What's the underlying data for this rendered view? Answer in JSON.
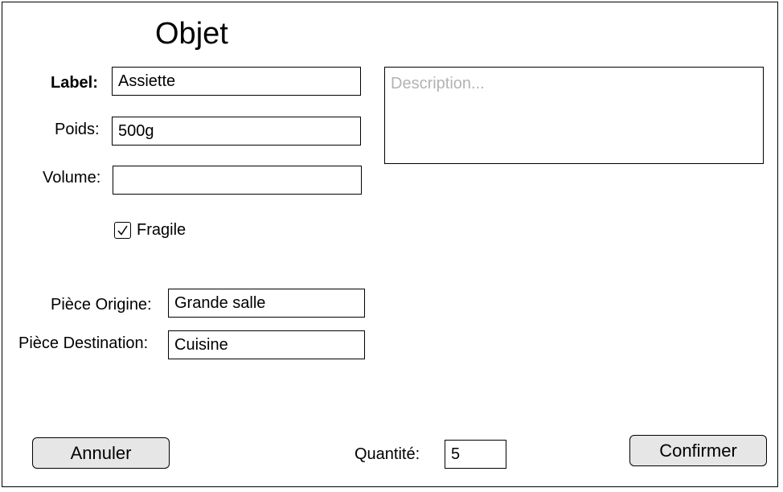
{
  "form": {
    "title": "Objet",
    "label": {
      "caption": "Label:",
      "value": "Assiette"
    },
    "poids": {
      "caption": "Poids:",
      "value": "500g"
    },
    "volume": {
      "caption": "Volume:",
      "value": ""
    },
    "description": {
      "placeholder": "Description...",
      "value": ""
    },
    "fragile": {
      "caption": "Fragile",
      "checked": true
    },
    "piece_origine": {
      "caption": "Pièce Origine:",
      "value": "Grande salle"
    },
    "piece_destination": {
      "caption": "Pièce Destination:",
      "value": "Cuisine"
    },
    "quantite": {
      "caption": "Quantité:",
      "value": "5"
    }
  },
  "actions": {
    "cancel_label": "Annuler",
    "confirm_label": "Confirmer"
  }
}
